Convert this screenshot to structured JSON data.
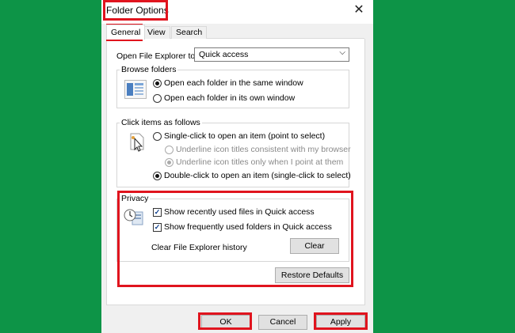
{
  "dialog": {
    "title": "Folder Options",
    "close": "✕",
    "tabs": [
      "General",
      "View",
      "Search"
    ]
  },
  "general": {
    "open_explorer_label": "Open File Explorer to:",
    "open_explorer_value": "Quick access",
    "browse_folders": {
      "title": "Browse folders",
      "options": [
        "Open each folder in the same window",
        "Open each folder in its own window"
      ],
      "selected": 0
    },
    "click_items": {
      "title": "Click items as follows",
      "single_click": "Single-click to open an item (point to select)",
      "underline_1": "Underline icon titles consistent with my browser",
      "underline_2": "Underline icon titles only when I point at them",
      "double_click": "Double-click to open an item (single-click to select)"
    },
    "privacy": {
      "title": "Privacy",
      "recent_files": "Show recently used files in Quick access",
      "frequent_folders": "Show frequently used folders in Quick access",
      "clear_label": "Clear File Explorer history",
      "clear_button": "Clear"
    },
    "restore_defaults": "Restore Defaults"
  },
  "footer": {
    "ok": "OK",
    "cancel": "Cancel",
    "apply": "Apply"
  },
  "colors": {
    "background_green": "#0d9447",
    "highlight_red": "#e0141e"
  }
}
